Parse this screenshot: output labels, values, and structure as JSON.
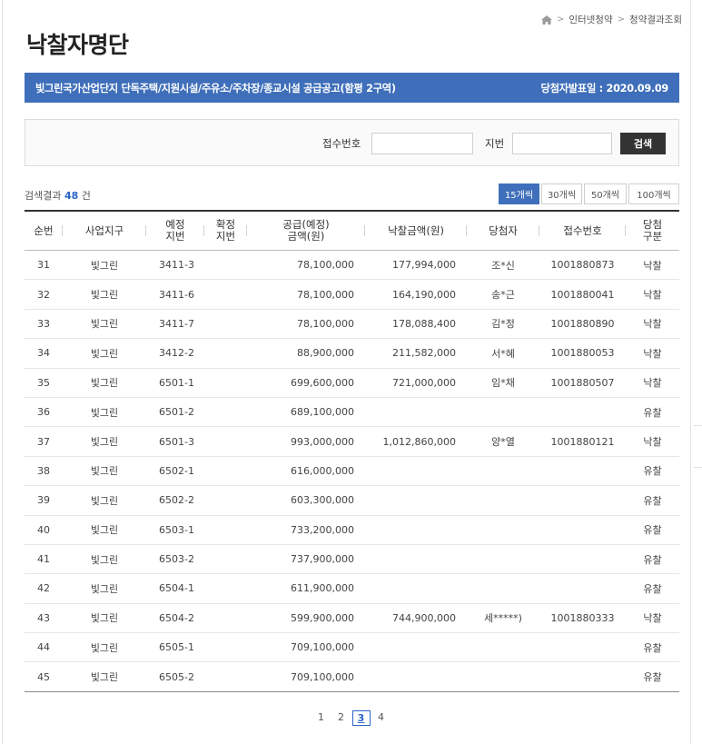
{
  "breadcrumb": {
    "items": [
      "인터넷청약",
      "청약결과조회"
    ],
    "sep": ">"
  },
  "page_title": "낙찰자명단",
  "banner": {
    "title": "빛그린국가산업단지 단독주택/지원시설/주유소/주차장/종교시설 공급공고(함평 2구역)",
    "date": "당첨자발표일 : 2020.09.09"
  },
  "search": {
    "receipt_label": "접수번호",
    "receipt_value": "",
    "lot_label": "지번",
    "lot_value": "",
    "button_label": "검색"
  },
  "result": {
    "prefix": "검색결과",
    "count": "48",
    "suffix": "건"
  },
  "per_page": [
    "15개씩",
    "30개씩",
    "50개씩",
    "100개씩"
  ],
  "per_page_selected": "15개씩",
  "table": {
    "headers": [
      [
        "순번"
      ],
      [
        "사업지구"
      ],
      [
        "예정",
        "지번"
      ],
      [
        "확정",
        "지번"
      ],
      [
        "공급(예정)",
        "금액(원)"
      ],
      [
        "낙찰금액(원)"
      ],
      [
        "당첨자"
      ],
      [
        "접수번호"
      ],
      [
        "당첨",
        "구분"
      ]
    ],
    "rows": [
      [
        "31",
        "빛그린",
        "3411-3",
        "",
        "78,100,000",
        "177,994,000",
        "조*신",
        "1001880873",
        "낙찰"
      ],
      [
        "32",
        "빛그린",
        "3411-6",
        "",
        "78,100,000",
        "164,190,000",
        "송*근",
        "1001880041",
        "낙찰"
      ],
      [
        "33",
        "빛그린",
        "3411-7",
        "",
        "78,100,000",
        "178,088,400",
        "김*정",
        "1001880890",
        "낙찰"
      ],
      [
        "34",
        "빛그린",
        "3412-2",
        "",
        "88,900,000",
        "211,582,000",
        "서*혜",
        "1001880053",
        "낙찰"
      ],
      [
        "35",
        "빛그린",
        "6501-1",
        "",
        "699,600,000",
        "721,000,000",
        "임*채",
        "1001880507",
        "낙찰"
      ],
      [
        "36",
        "빛그린",
        "6501-2",
        "",
        "689,100,000",
        "",
        "",
        "",
        "유찰"
      ],
      [
        "37",
        "빛그린",
        "6501-3",
        "",
        "993,000,000",
        "1,012,860,000",
        "양*열",
        "1001880121",
        "낙찰"
      ],
      [
        "38",
        "빛그린",
        "6502-1",
        "",
        "616,000,000",
        "",
        "",
        "",
        "유찰"
      ],
      [
        "39",
        "빛그린",
        "6502-2",
        "",
        "603,300,000",
        "",
        "",
        "",
        "유찰"
      ],
      [
        "40",
        "빛그린",
        "6503-1",
        "",
        "733,200,000",
        "",
        "",
        "",
        "유찰"
      ],
      [
        "41",
        "빛그린",
        "6503-2",
        "",
        "737,900,000",
        "",
        "",
        "",
        "유찰"
      ],
      [
        "42",
        "빛그린",
        "6504-1",
        "",
        "611,900,000",
        "",
        "",
        "",
        "유찰"
      ],
      [
        "43",
        "빛그린",
        "6504-2",
        "",
        "599,900,000",
        "744,900,000",
        "세*****)",
        "1001880333",
        "낙찰"
      ],
      [
        "44",
        "빛그린",
        "6505-1",
        "",
        "709,100,000",
        "",
        "",
        "",
        "유찰"
      ],
      [
        "45",
        "빛그린",
        "6505-2",
        "",
        "709,100,000",
        "",
        "",
        "",
        "유찰"
      ]
    ]
  },
  "pagination": {
    "pages": [
      "1",
      "2",
      "3",
      "4"
    ],
    "current": "3"
  },
  "colors": {
    "accent": "#3f6fba",
    "link": "#2a63c8",
    "button": "#333333"
  }
}
